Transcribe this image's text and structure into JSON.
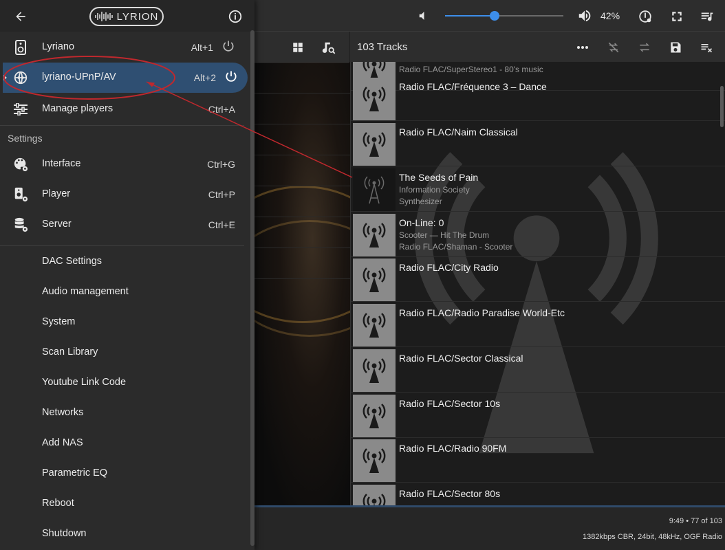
{
  "app": {
    "logo_text": "LYRION"
  },
  "topbar": {
    "volume_percent": 42,
    "volume_label": "42%"
  },
  "queue": {
    "tracks_label": "103 Tracks",
    "items": [
      {
        "title": "",
        "sub1": "Radio FLAC/SuperStereo1 - 80's music",
        "sub2": "",
        "thumb": "radio"
      },
      {
        "title": "Radio FLAC/Fréquence 3 – Dance",
        "sub1": "",
        "sub2": "",
        "thumb": "radio"
      },
      {
        "title": "Radio FLAC/Naim Classical",
        "sub1": "",
        "sub2": "",
        "thumb": "radio"
      },
      {
        "title": "The Seeds of Pain",
        "sub1": "Information Society",
        "sub2": "Synthesizer",
        "thumb": "dark"
      },
      {
        "title": "On-Line: 0",
        "sub1": "Scooter — Hit The Drum",
        "sub2": "Radio FLAC/Shaman - Scooter",
        "thumb": "radio"
      },
      {
        "title": "Radio FLAC/City Radio",
        "sub1": "",
        "sub2": "",
        "thumb": "radio"
      },
      {
        "title": "Radio FLAC/Radio Paradise World-Etc",
        "sub1": "",
        "sub2": "",
        "thumb": "radio"
      },
      {
        "title": "Radio FLAC/Sector Classical",
        "sub1": "",
        "sub2": "",
        "thumb": "radio"
      },
      {
        "title": "Radio FLAC/Sector 10s",
        "sub1": "",
        "sub2": "",
        "thumb": "radio"
      },
      {
        "title": "Radio FLAC/Radio 90FM",
        "sub1": "",
        "sub2": "",
        "thumb": "radio"
      },
      {
        "title": "Radio FLAC/Sector 80s",
        "sub1": "",
        "sub2": "",
        "thumb": "radio"
      }
    ]
  },
  "bottombar": {
    "position": "9:49 • 77 of 103",
    "format": "1382kbps CBR, 24bit, 48kHz, OGF Radio"
  },
  "drawer": {
    "players": [
      {
        "label": "Lyriano",
        "shortcut": "Alt+1",
        "icon": "speaker-icon"
      },
      {
        "label": "lyriano-UPnP/AV",
        "shortcut": "Alt+2",
        "icon": "upnp-icon"
      }
    ],
    "manage": {
      "label": "Manage players",
      "shortcut": "Ctrl+A"
    },
    "settings_header": "Settings",
    "settings": [
      {
        "label": "Interface",
        "shortcut": "Ctrl+G"
      },
      {
        "label": "Player",
        "shortcut": "Ctrl+P"
      },
      {
        "label": "Server",
        "shortcut": "Ctrl+E"
      }
    ],
    "extras": [
      "DAC Settings",
      "Audio management",
      "System",
      "Scan Library",
      "Youtube Link Code",
      "Networks",
      "Add NAS",
      "Parametric EQ",
      "Reboot",
      "Shutdown"
    ]
  },
  "colors": {
    "accent": "#3d8eea",
    "active_item": "#2f4f72",
    "annotation": "#c0282d"
  }
}
